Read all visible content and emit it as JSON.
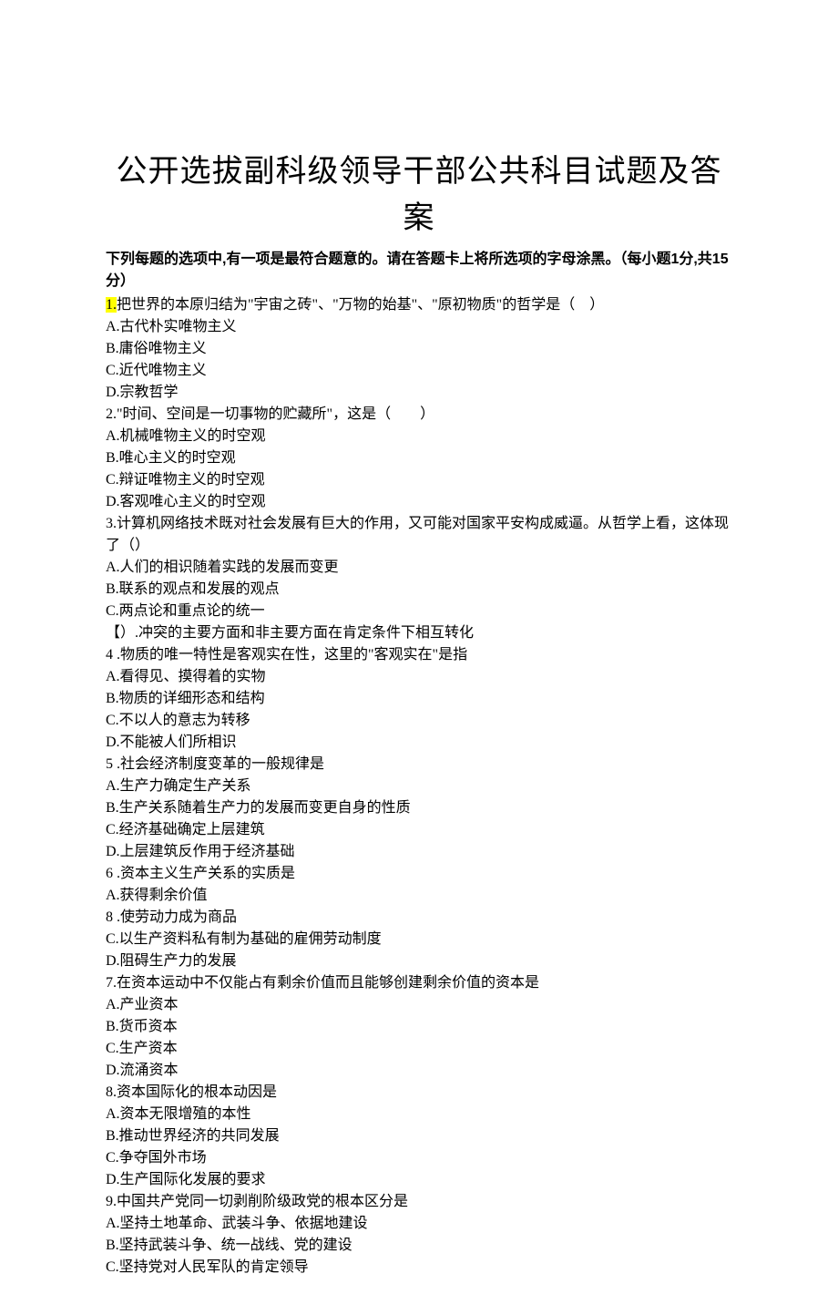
{
  "title": "公开选拔副科级领导干部公共科目试题及答案",
  "instructions": "下列每题的选项中,有一项是最符合题意的。请在答题卡上将所选项的字母涂黑。（每小题1分,共15分）",
  "questions": [
    {
      "num": "1.",
      "highlight": true,
      "text": "把世界的本原归结为\"宇宙之砖\"、\"万物的始基\"、\"原初物质\"的哲学是（　）",
      "options": [
        "A.古代朴实唯物主义",
        "B.庸俗唯物主义",
        "C.近代唯物主义",
        "D.宗教哲学"
      ]
    },
    {
      "num": "2.",
      "highlight": false,
      "text": "\"时间、空间是一切事物的贮藏所\"，这是（　　）",
      "options": [
        "A.机械唯物主义的时空观",
        "B.唯心主义的时空观",
        "C.辩证唯物主义的时空观",
        "D.客观唯心主义的时空观"
      ]
    },
    {
      "num": "3.",
      "highlight": false,
      "text": "计算机网络技术既对社会发展有巨大的作用，又可能对国家平安构成威逼。从哲学上看，这体现了（）",
      "options": [
        "A.人们的相识随着实践的发展而变更",
        "B.联系的观点和发展的观点",
        "C.两点论和重点论的统一",
        "【）.冲突的主要方面和非主要方面在肯定条件下相互转化"
      ]
    },
    {
      "num": "4",
      "highlight": false,
      "text": " .物质的唯一特性是客观实在性，这里的\"客观实在\"是指",
      "options": [
        "A.看得见、摸得着的实物",
        "B.物质的详细形态和结构",
        "C.不以人的意志为转移",
        "D.不能被人们所相识"
      ]
    },
    {
      "num": "5",
      "highlight": false,
      "text": " .社会经济制度变革的一般规律是",
      "options": [
        "A.生产力确定生产关系",
        "B.生产关系随着生产力的发展而变更自身的性质",
        "C.经济基础确定上层建筑",
        "D.上层建筑反作用于经济基础"
      ]
    },
    {
      "num": "6",
      "highlight": false,
      "text": " .资本主义生产关系的实质是",
      "options": [
        "A.获得剩余价值",
        "8 .使劳动力成为商品",
        "C.以生产资料私有制为基础的雇佣劳动制度",
        "D.阻碍生产力的发展"
      ]
    },
    {
      "num": "7.",
      "highlight": false,
      "text": "在资本运动中不仅能占有剩余价值而且能够创建剩余价值的资本是",
      "options": [
        "A.产业资本",
        "B.货币资本",
        "C.生产资本",
        "D.流涌资本"
      ]
    },
    {
      "num": "8.",
      "highlight": false,
      "text": "资本国际化的根本动因是",
      "options": [
        "A.资本无限增殖的本性",
        "B.推动世界经济的共同发展",
        "C.争夺国外市场",
        "D.生产国际化发展的要求"
      ]
    },
    {
      "num": "9.",
      "highlight": false,
      "text": "中国共产党同一切剥削阶级政党的根本区分是",
      "options": [
        "A.坚持土地革命、武装斗争、依据地建设",
        "B.坚持武装斗争、统一战线、党的建设",
        "C.坚持党对人民军队的肯定领导"
      ]
    }
  ]
}
